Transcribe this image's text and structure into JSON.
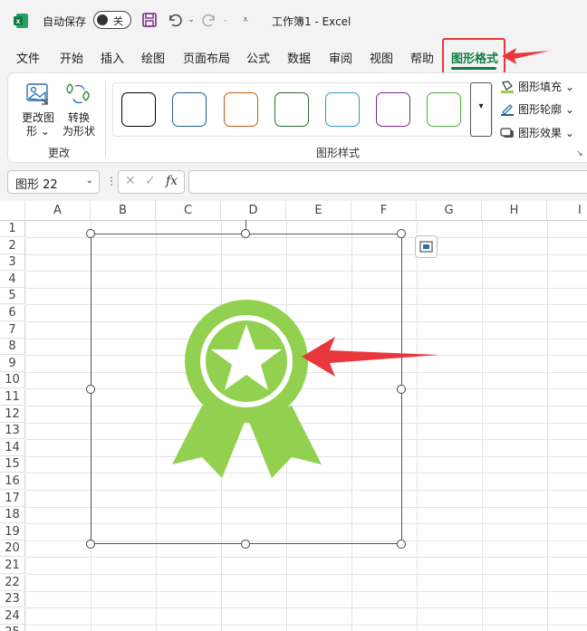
{
  "titlebar": {
    "autosave_label": "自动保存",
    "toggle_state": "关",
    "title": "工作簿1  -  Excel",
    "icons": [
      "excel-logo-icon",
      "save-icon",
      "undo-icon",
      "redo-icon",
      "customize-qat-icon"
    ]
  },
  "tabs": [
    "文件",
    "开始",
    "插入",
    "绘图",
    "页面布局",
    "公式",
    "数据",
    "审阅",
    "视图",
    "帮助",
    "图形格式"
  ],
  "active_tab": "图形格式",
  "ribbon": {
    "change_shape_label": "更改图",
    "change_shape_label2": "形 ⌄",
    "convert_label": "转换",
    "convert_label2": "为形状",
    "group_change": "更改",
    "group_styles": "图形样式",
    "shape_fill": "图形填充 ⌄",
    "shape_outline": "图形轮廓 ⌄",
    "shape_effects": "图形效果 ⌄",
    "swatch_colors": [
      "#000000",
      "#1f5e8c",
      "#c55a11",
      "#2d6a2f",
      "#2a9bc0",
      "#7a2a8c",
      "#4caf3f"
    ]
  },
  "formula_bar": {
    "name_box": "图形 22",
    "fx": "fx",
    "value": ""
  },
  "sheet": {
    "columns": [
      "A",
      "B",
      "C",
      "D",
      "E",
      "F",
      "G",
      "H",
      "I"
    ],
    "rows": [
      "1",
      "2",
      "3",
      "4",
      "5",
      "6",
      "7",
      "8",
      "9",
      "10",
      "11",
      "12",
      "13",
      "14",
      "15",
      "16",
      "17",
      "18",
      "19",
      "20",
      "21",
      "22",
      "23",
      "24",
      "25"
    ]
  },
  "colors": {
    "accent": "#107c41",
    "badge_green": "#92d050",
    "annotation_red": "#e8383d"
  }
}
